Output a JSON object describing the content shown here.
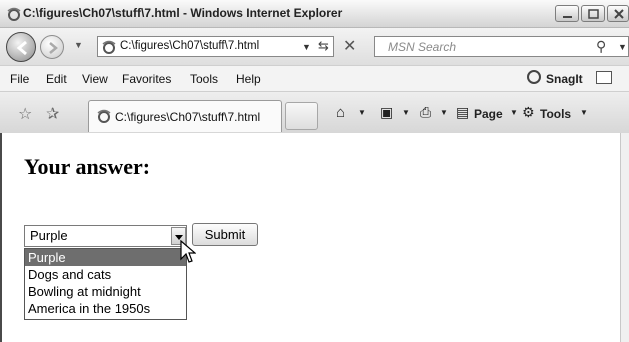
{
  "window": {
    "title": "C:\\figures\\Ch07\\stuff\\7.html - Windows Internet Explorer"
  },
  "address_bar": {
    "url": "C:\\figures\\Ch07\\stuff\\7.html",
    "search_placeholder": "MSN Search"
  },
  "menu": {
    "items": [
      "File",
      "Edit",
      "View",
      "Favorites",
      "Tools",
      "Help"
    ],
    "snagit_label": "SnagIt"
  },
  "tabs": {
    "active_label": "C:\\figures\\Ch07\\stuff\\7.html"
  },
  "command_bar": {
    "page_label": "Page",
    "tools_label": "Tools"
  },
  "page": {
    "heading": "Your answer:",
    "select": {
      "selected_value": "Purple",
      "options": [
        "Purple",
        "Dogs and cats",
        "Bowling at midnight",
        "America in the 1950s"
      ],
      "highlighted_index": 0
    },
    "submit_label": "Submit"
  },
  "colors": {
    "highlight": "#6e6e6e"
  }
}
